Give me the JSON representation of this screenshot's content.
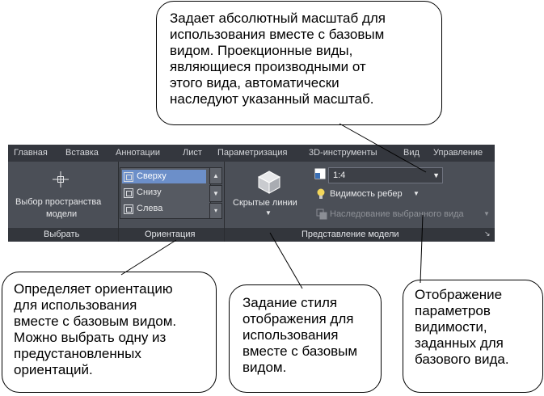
{
  "ribbon": {
    "tabs": [
      {
        "label": "Главная"
      },
      {
        "label": "Вставка"
      },
      {
        "label": "Аннотации"
      },
      {
        "label": "Лист"
      },
      {
        "label": "Параметризация"
      },
      {
        "label": "3D-инструменты"
      },
      {
        "label": "Вид"
      },
      {
        "label": "Управление"
      }
    ],
    "select_panel": {
      "button_label_line1": "Выбор пространства",
      "button_label_line2": "модели",
      "footer": "Выбрать"
    },
    "orientation_panel": {
      "items": [
        {
          "label": "Сверху",
          "selected": true
        },
        {
          "label": "Снизу",
          "selected": false
        },
        {
          "label": "Слева",
          "selected": false
        }
      ],
      "footer": "Ориентация"
    },
    "model_view_panel": {
      "hidden_lines_label": "Скрытые линии",
      "scale_value": "1:4",
      "edge_visibility_label": "Видимость ребер",
      "inherit_label": "Наследование выбранного вида",
      "footer": "Представление модели"
    }
  },
  "callouts": {
    "scale": "Задает абсолютный масштаб для\nиспользования вместе с базовым\nвидом. Проекционные виды,\nявляющиеся производными от\nэтого вида, автоматически\nнаследуют указанный масштаб.",
    "orientation": "Определяет ориентацию\nдля использования\nвместе с базовым видом.\nМожно выбрать одну из\nпредустановленных\nориентаций.",
    "style": "Задание стиля\nотображения для\nиспользования\nвместе с базовым\nвидом.",
    "visibility": "Отображение\nпараметров\nвидимости,\nзаданных для\nбазового вида."
  },
  "colors": {
    "ribbon_tab_bg": "#34373e",
    "ribbon_panel_bg": "#4b4f57",
    "selection": "#6c8fc9"
  }
}
